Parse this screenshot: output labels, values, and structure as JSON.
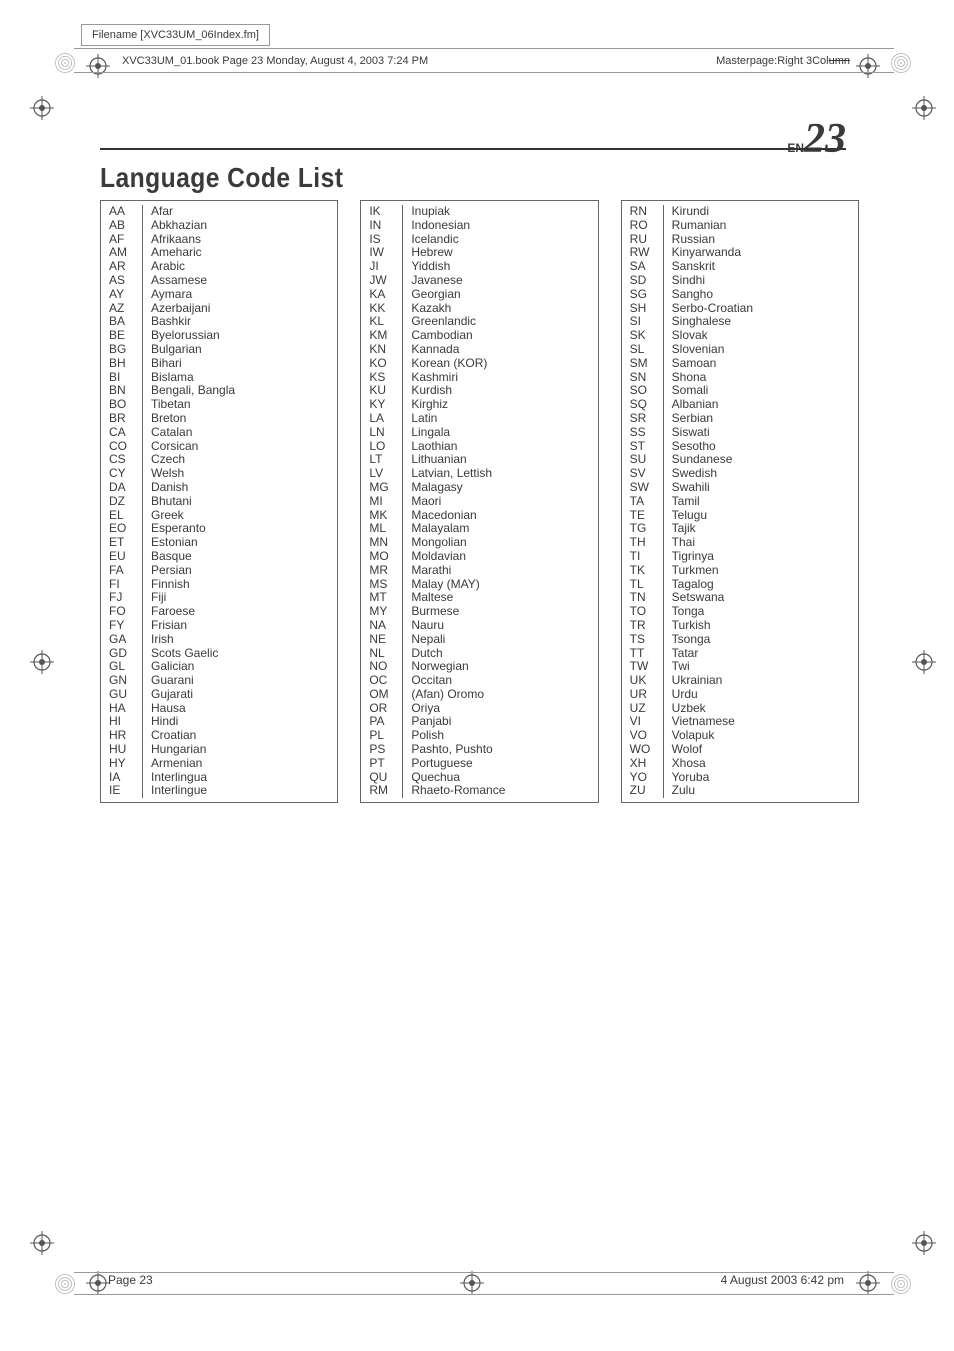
{
  "filename_label": "Filename [XVC33UM_06Index.fm]",
  "book_line": "XVC33UM_01.book  Page 23  Monday, August 4, 2003  7:24 PM",
  "masterpage_prefix": "Masterpage:Right 3Col",
  "masterpage_strike": "umn",
  "page_lang": "EN",
  "page_number": "23",
  "title": "Language Code List",
  "footer_left": "Page 23",
  "footer_right": "4 August 2003 6:42 pm",
  "columns": [
    [
      [
        "AA",
        "Afar"
      ],
      [
        "AB",
        "Abkhazian"
      ],
      [
        "AF",
        "Afrikaans"
      ],
      [
        "AM",
        "Ameharic"
      ],
      [
        "AR",
        "Arabic"
      ],
      [
        "AS",
        "Assamese"
      ],
      [
        "AY",
        "Aymara"
      ],
      [
        "AZ",
        "Azerbaijani"
      ],
      [
        "BA",
        "Bashkir"
      ],
      [
        "BE",
        "Byelorussian"
      ],
      [
        "BG",
        "Bulgarian"
      ],
      [
        "BH",
        "Bihari"
      ],
      [
        "BI",
        "Bislama"
      ],
      [
        "BN",
        "Bengali, Bangla"
      ],
      [
        "BO",
        "Tibetan"
      ],
      [
        "BR",
        "Breton"
      ],
      [
        "CA",
        "Catalan"
      ],
      [
        "CO",
        "Corsican"
      ],
      [
        "CS",
        "Czech"
      ],
      [
        "CY",
        "Welsh"
      ],
      [
        "DA",
        "Danish"
      ],
      [
        "DZ",
        "Bhutani"
      ],
      [
        "EL",
        "Greek"
      ],
      [
        "EO",
        "Esperanto"
      ],
      [
        "ET",
        "Estonian"
      ],
      [
        "EU",
        "Basque"
      ],
      [
        "FA",
        "Persian"
      ],
      [
        "FI",
        "Finnish"
      ],
      [
        "FJ",
        "Fiji"
      ],
      [
        "FO",
        "Faroese"
      ],
      [
        "FY",
        "Frisian"
      ],
      [
        "GA",
        "Irish"
      ],
      [
        "GD",
        "Scots Gaelic"
      ],
      [
        "GL",
        "Galician"
      ],
      [
        "GN",
        "Guarani"
      ],
      [
        "GU",
        "Gujarati"
      ],
      [
        "HA",
        "Hausa"
      ],
      [
        "HI",
        "Hindi"
      ],
      [
        "HR",
        "Croatian"
      ],
      [
        "HU",
        "Hungarian"
      ],
      [
        "HY",
        "Armenian"
      ],
      [
        "IA",
        "Interlingua"
      ],
      [
        "IE",
        "Interlingue"
      ]
    ],
    [
      [
        "IK",
        "Inupiak"
      ],
      [
        "IN",
        "Indonesian"
      ],
      [
        "IS",
        "Icelandic"
      ],
      [
        "IW",
        "Hebrew"
      ],
      [
        "JI",
        "Yiddish"
      ],
      [
        "JW",
        "Javanese"
      ],
      [
        "KA",
        "Georgian"
      ],
      [
        "KK",
        "Kazakh"
      ],
      [
        "KL",
        "Greenlandic"
      ],
      [
        "KM",
        "Cambodian"
      ],
      [
        "KN",
        "Kannada"
      ],
      [
        "KO",
        "Korean (KOR)"
      ],
      [
        "KS",
        "Kashmiri"
      ],
      [
        "KU",
        "Kurdish"
      ],
      [
        "KY",
        "Kirghiz"
      ],
      [
        "LA",
        "Latin"
      ],
      [
        "LN",
        "Lingala"
      ],
      [
        "LO",
        "Laothian"
      ],
      [
        "LT",
        "Lithuanian"
      ],
      [
        "LV",
        "Latvian, Lettish"
      ],
      [
        "MG",
        "Malagasy"
      ],
      [
        "MI",
        "Maori"
      ],
      [
        "MK",
        "Macedonian"
      ],
      [
        "ML",
        "Malayalam"
      ],
      [
        "MN",
        "Mongolian"
      ],
      [
        "MO",
        "Moldavian"
      ],
      [
        "MR",
        "Marathi"
      ],
      [
        "MS",
        "Malay (MAY)"
      ],
      [
        "MT",
        "Maltese"
      ],
      [
        "MY",
        "Burmese"
      ],
      [
        "NA",
        "Nauru"
      ],
      [
        "NE",
        "Nepali"
      ],
      [
        "NL",
        "Dutch"
      ],
      [
        "NO",
        "Norwegian"
      ],
      [
        "OC",
        "Occitan"
      ],
      [
        "OM",
        "(Afan) Oromo"
      ],
      [
        "OR",
        "Oriya"
      ],
      [
        "PA",
        "Panjabi"
      ],
      [
        "PL",
        "Polish"
      ],
      [
        "PS",
        "Pashto, Pushto"
      ],
      [
        "PT",
        "Portuguese"
      ],
      [
        "QU",
        "Quechua"
      ],
      [
        "RM",
        "Rhaeto-Romance"
      ]
    ],
    [
      [
        "RN",
        "Kirundi"
      ],
      [
        "RO",
        "Rumanian"
      ],
      [
        "RU",
        "Russian"
      ],
      [
        "RW",
        "Kinyarwanda"
      ],
      [
        "SA",
        "Sanskrit"
      ],
      [
        "SD",
        "Sindhi"
      ],
      [
        "SG",
        "Sangho"
      ],
      [
        "SH",
        "Serbo-Croatian"
      ],
      [
        "SI",
        "Singhalese"
      ],
      [
        "SK",
        "Slovak"
      ],
      [
        "SL",
        "Slovenian"
      ],
      [
        "SM",
        "Samoan"
      ],
      [
        "SN",
        "Shona"
      ],
      [
        "SO",
        "Somali"
      ],
      [
        "SQ",
        "Albanian"
      ],
      [
        "SR",
        "Serbian"
      ],
      [
        "SS",
        "Siswati"
      ],
      [
        "ST",
        "Sesotho"
      ],
      [
        "SU",
        "Sundanese"
      ],
      [
        "SV",
        "Swedish"
      ],
      [
        "SW",
        "Swahili"
      ],
      [
        "TA",
        "Tamil"
      ],
      [
        "TE",
        "Telugu"
      ],
      [
        "TG",
        "Tajik"
      ],
      [
        "TH",
        "Thai"
      ],
      [
        "TI",
        "Tigrinya"
      ],
      [
        "TK",
        "Turkmen"
      ],
      [
        "TL",
        "Tagalog"
      ],
      [
        "TN",
        "Setswana"
      ],
      [
        "TO",
        "Tonga"
      ],
      [
        "TR",
        "Turkish"
      ],
      [
        "TS",
        "Tsonga"
      ],
      [
        "TT",
        "Tatar"
      ],
      [
        "TW",
        "Twi"
      ],
      [
        "UK",
        "Ukrainian"
      ],
      [
        "UR",
        "Urdu"
      ],
      [
        "UZ",
        "Uzbek"
      ],
      [
        "VI",
        "Vietnamese"
      ],
      [
        "VO",
        "Volapuk"
      ],
      [
        "WO",
        "Wolof"
      ],
      [
        "XH",
        "Xhosa"
      ],
      [
        "YO",
        "Yoruba"
      ],
      [
        "ZU",
        "Zulu"
      ]
    ]
  ]
}
